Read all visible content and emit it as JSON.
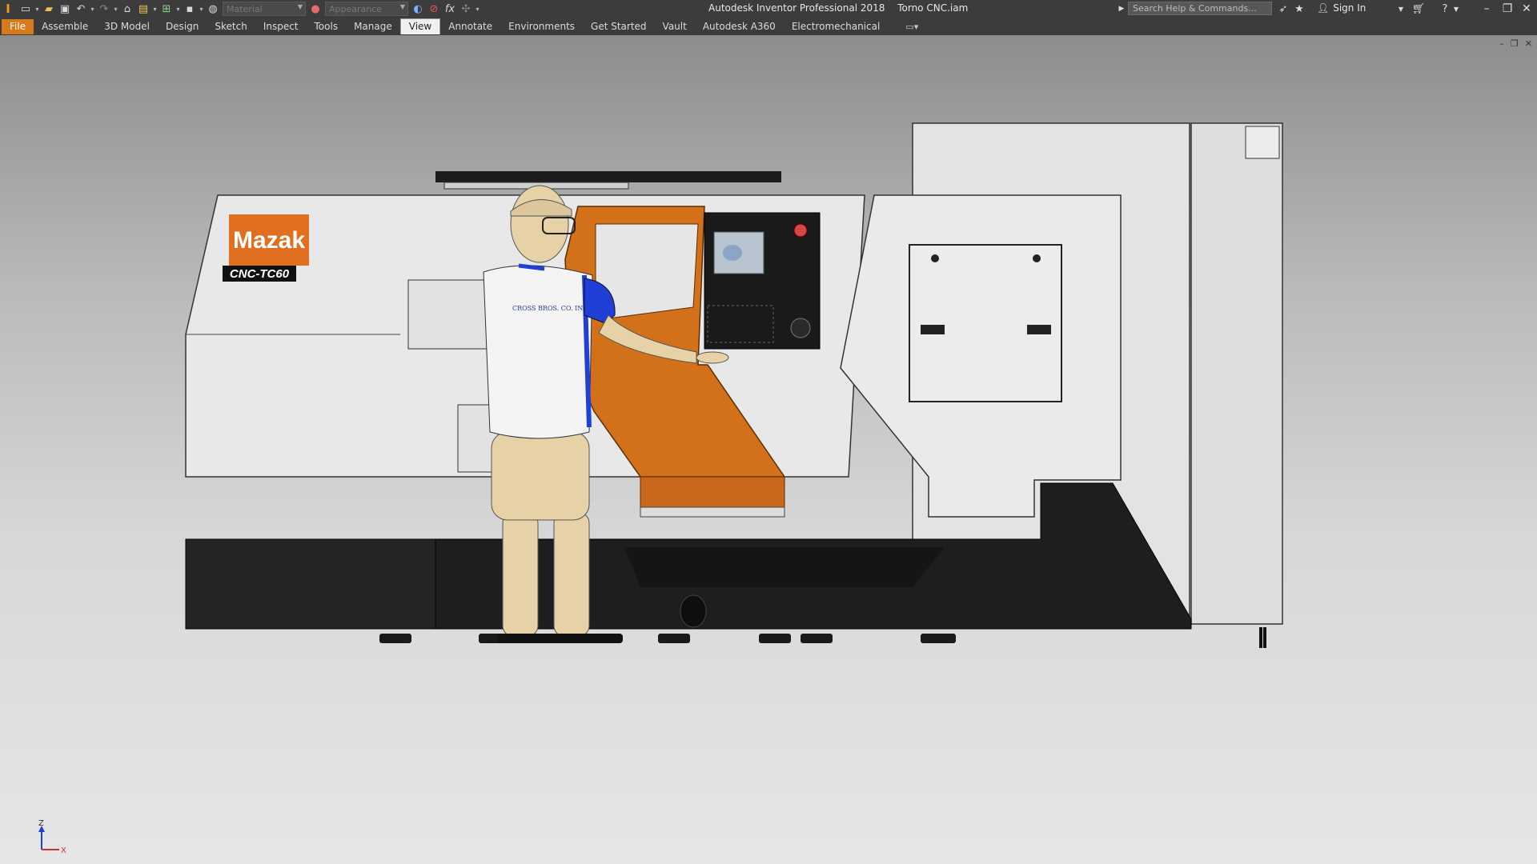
{
  "app": {
    "name": "Autodesk Inventor Professional 2018",
    "document": "Torno CNC.iam"
  },
  "quick_access": {
    "material_placeholder": "Material",
    "appearance_placeholder": "Appearance",
    "icons": [
      "new-icon",
      "open-icon",
      "save-icon",
      "undo-icon",
      "redo-icon",
      "home-icon",
      "print-icon",
      "measure-icon",
      "select-icon",
      "material-globe-icon",
      "appearance-sphere-icon",
      "color-override-icon",
      "clear-override-icon",
      "function-icon",
      "update-icon",
      "more-icon"
    ]
  },
  "search": {
    "placeholder": "Search Help & Commands..."
  },
  "account": {
    "sign_in": "Sign In"
  },
  "ribbon": {
    "tabs": [
      "File",
      "Assemble",
      "3D Model",
      "Design",
      "Sketch",
      "Inspect",
      "Tools",
      "Manage",
      "View",
      "Annotate",
      "Environments",
      "Get Started",
      "Vault",
      "Autodesk A360",
      "Electromechanical"
    ],
    "active_tab": "View"
  },
  "model": {
    "brand": "Mazak",
    "model_name": "CNC-TC60",
    "shirt_text": "CROSS BROS. CO. INC."
  },
  "triad": {
    "z": "Z",
    "x": "X"
  },
  "colors": {
    "accent_orange": "#d87a1c",
    "machine_orange": "#d2711a",
    "machine_black": "#1f1f1f",
    "humanoid_skin": "#e6d2a6",
    "shirt_blue": "#1f3fd6"
  }
}
